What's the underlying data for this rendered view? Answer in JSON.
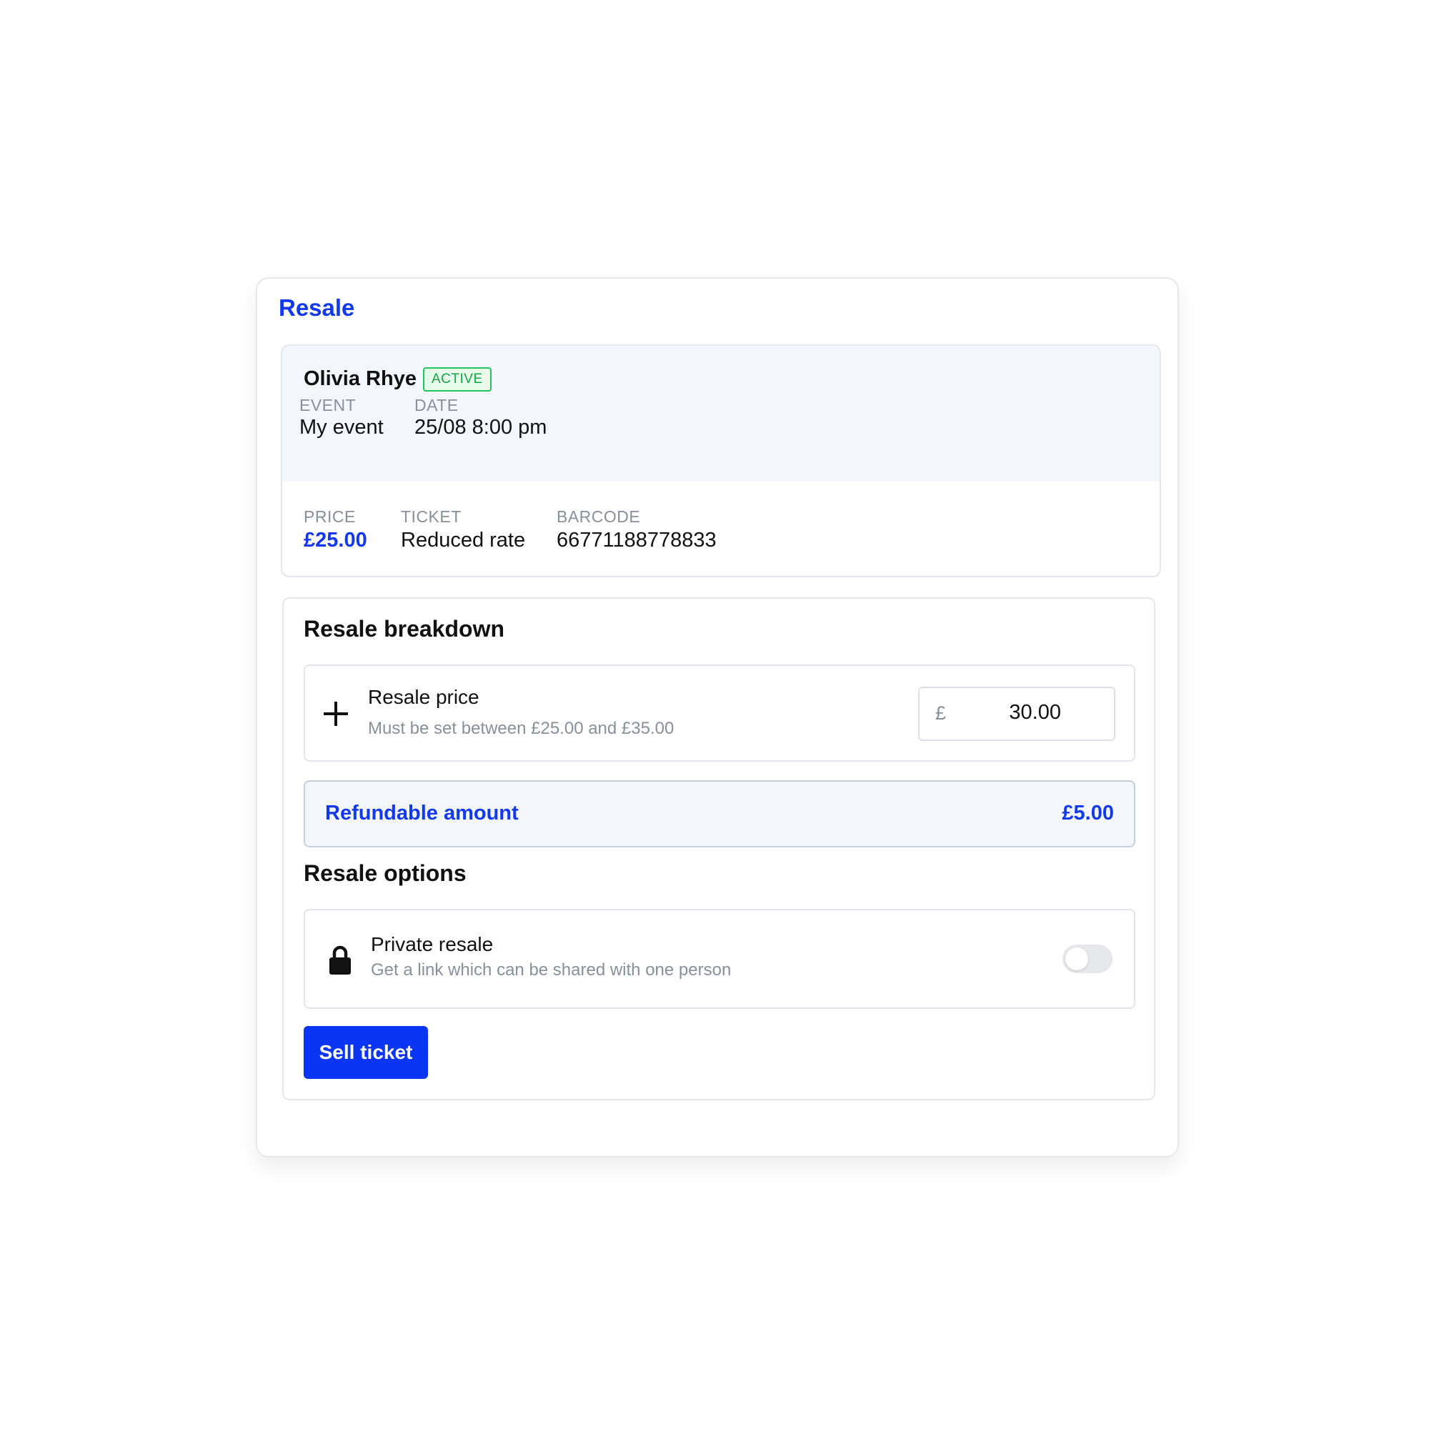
{
  "card": {
    "title": "Resale"
  },
  "ticket": {
    "holder_name": "Olivia Rhye",
    "status": "ACTIVE",
    "event_label": "EVENT",
    "event_value": "My event",
    "date_label": "DATE",
    "date_value": "25/08 8:00 pm",
    "price_label": "PRICE",
    "price_value": "£25.00",
    "ticket_label": "TICKET",
    "ticket_value": "Reduced rate",
    "barcode_label": "BARCODE",
    "barcode_value": "66771188778833"
  },
  "breakdown": {
    "heading": "Resale breakdown",
    "resale_price": {
      "icon": "plus-icon",
      "title": "Resale price",
      "hint": "Must be set between £25.00 and £35.00",
      "currency_symbol": "£",
      "value": "30.00"
    },
    "refundable": {
      "label": "Refundable amount",
      "value": "£5.00"
    }
  },
  "options": {
    "heading": "Resale options",
    "private_resale": {
      "icon": "lock-icon",
      "title": "Private resale",
      "description": "Get a link which can be shared with one person",
      "enabled": false
    }
  },
  "actions": {
    "sell_label": "Sell ticket"
  },
  "colors": {
    "accent": "#1238f0",
    "button": "#0a35f5",
    "status_green": "#16a34a",
    "ticket_bg": "#f3f6fd",
    "muted_text": "#8a8f99"
  }
}
